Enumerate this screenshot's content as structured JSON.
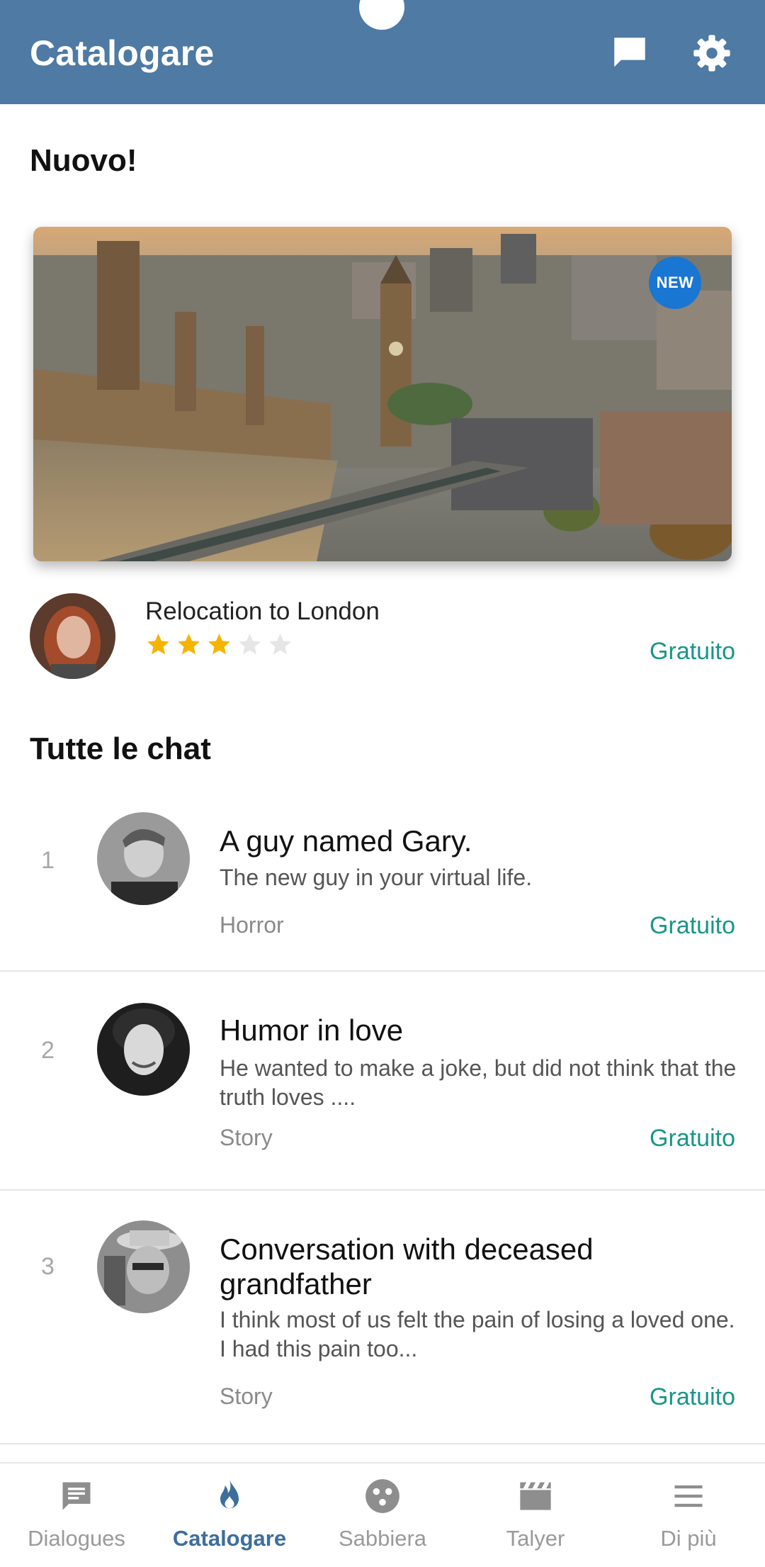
{
  "appbar": {
    "title": "Catalogare",
    "icons": [
      "chat-bubble-icon",
      "gear-icon"
    ]
  },
  "featured": {
    "section_title": "Nuovo!",
    "badge": "NEW",
    "title": "Relocation to London",
    "rating": 3,
    "rating_max": 5,
    "price": "Gratuito"
  },
  "all_chats": {
    "section_title": "Tutte le chat",
    "items": [
      {
        "rank": "1",
        "title": "A guy named Gary.",
        "description": "The new guy in your virtual life.",
        "genre": "Horror",
        "price": "Gratuito"
      },
      {
        "rank": "2",
        "title": "Humor in love",
        "description": "He wanted to make a joke, but did not think that the truth loves ....",
        "genre": "Story",
        "price": "Gratuito"
      },
      {
        "rank": "3",
        "title": "Conversation with deceased grandfather",
        "description": "I think most of us felt the pain of losing a loved one. I had this pain too...",
        "genre": "Story",
        "price": "Gratuito"
      }
    ]
  },
  "bottom_nav": {
    "items": [
      {
        "label": "Dialogues",
        "icon": "message-icon"
      },
      {
        "label": "Catalogare",
        "icon": "flame-icon"
      },
      {
        "label": "Sabbiera",
        "icon": "sandbox-icon"
      },
      {
        "label": "Talyer",
        "icon": "clapperboard-icon"
      },
      {
        "label": "Di più",
        "icon": "menu-icon"
      }
    ],
    "active_index": 1
  },
  "colors": {
    "appbar": "#4e7aa4",
    "price": "#179688",
    "badge": "#1976d2",
    "star_filled": "#f5b400",
    "star_empty": "#e6e6e6",
    "nav_active": "#3d6e9c",
    "nav_inactive": "#9a9a9a"
  }
}
